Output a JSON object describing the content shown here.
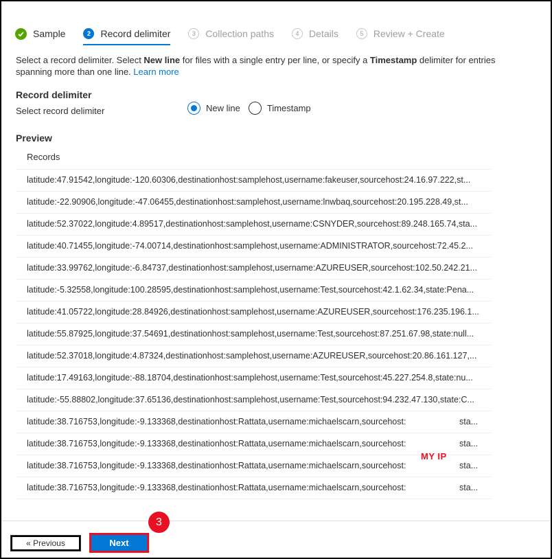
{
  "steps": [
    {
      "num": "",
      "label": "Sample",
      "state": "done"
    },
    {
      "num": "2",
      "label": "Record delimiter",
      "state": "active"
    },
    {
      "num": "3",
      "label": "Collection paths",
      "state": "todo"
    },
    {
      "num": "4",
      "label": "Details",
      "state": "todo"
    },
    {
      "num": "5",
      "label": "Review + Create",
      "state": "todo"
    }
  ],
  "intro": {
    "part1": "Select a record delimiter. Select ",
    "bold1": "New line",
    "part2": " for files with a single entry per line, or specify a ",
    "bold2": "Timestamp",
    "part3": " delimiter for entries spanning more than one line. ",
    "link": "Learn more"
  },
  "delimiter": {
    "title": "Record delimiter",
    "field_label": "Select record delimiter",
    "options": [
      "New line",
      "Timestamp"
    ],
    "selected": "New line"
  },
  "preview": {
    "title": "Preview",
    "column": "Records",
    "rows": [
      "latitude:47.91542,longitude:-120.60306,destinationhost:samplehost,username:fakeuser,sourcehost:24.16.97.222,st...",
      "latitude:-22.90906,longitude:-47.06455,destinationhost:samplehost,username:lnwbaq,sourcehost:20.195.228.49,st...",
      "latitude:52.37022,longitude:4.89517,destinationhost:samplehost,username:CSNYDER,sourcehost:89.248.165.74,sta...",
      "latitude:40.71455,longitude:-74.00714,destinationhost:samplehost,username:ADMINISTRATOR,sourcehost:72.45.2...",
      "latitude:33.99762,longitude:-6.84737,destinationhost:samplehost,username:AZUREUSER,sourcehost:102.50.242.21...",
      "latitude:-5.32558,longitude:100.28595,destinationhost:samplehost,username:Test,sourcehost:42.1.62.34,state:Pena...",
      "latitude:41.05722,longitude:28.84926,destinationhost:samplehost,username:AZUREUSER,sourcehost:176.235.196.1...",
      "latitude:55.87925,longitude:37.54691,destinationhost:samplehost,username:Test,sourcehost:87.251.67.98,state:null...",
      "latitude:52.37018,longitude:4.87324,destinationhost:samplehost,username:AZUREUSER,sourcehost:20.86.161.127,...",
      "latitude:17.49163,longitude:-88.18704,destinationhost:samplehost,username:Test,sourcehost:45.227.254.8,state:nu...",
      "latitude:-55.88802,longitude:37.65136,destinationhost:samplehost,username:Test,sourcehost:94.232.47.130,state:C..."
    ],
    "redacted_rows": [
      {
        "text": "latitude:38.716753,longitude:-9.133368,destinationhost:Rattata,username:michaelscarn,sourcehost:",
        "tail": "sta..."
      },
      {
        "text": "latitude:38.716753,longitude:-9.133368,destinationhost:Rattata,username:michaelscarn,sourcehost:",
        "tail": "sta..."
      },
      {
        "text": "latitude:38.716753,longitude:-9.133368,destinationhost:Rattata,username:michaelscarn,sourcehost:",
        "tail": "sta..."
      },
      {
        "text": "latitude:38.716753,longitude:-9.133368,destinationhost:Rattata,username:michaelscarn,sourcehost:",
        "tail": "sta..."
      }
    ],
    "annotation": "MY IP"
  },
  "footer": {
    "previous_label": "« Previous",
    "next_label": "Next",
    "callout_number": "3"
  },
  "colors": {
    "accent": "#0078d4",
    "success": "#57a300",
    "highlight": "#e81123"
  }
}
